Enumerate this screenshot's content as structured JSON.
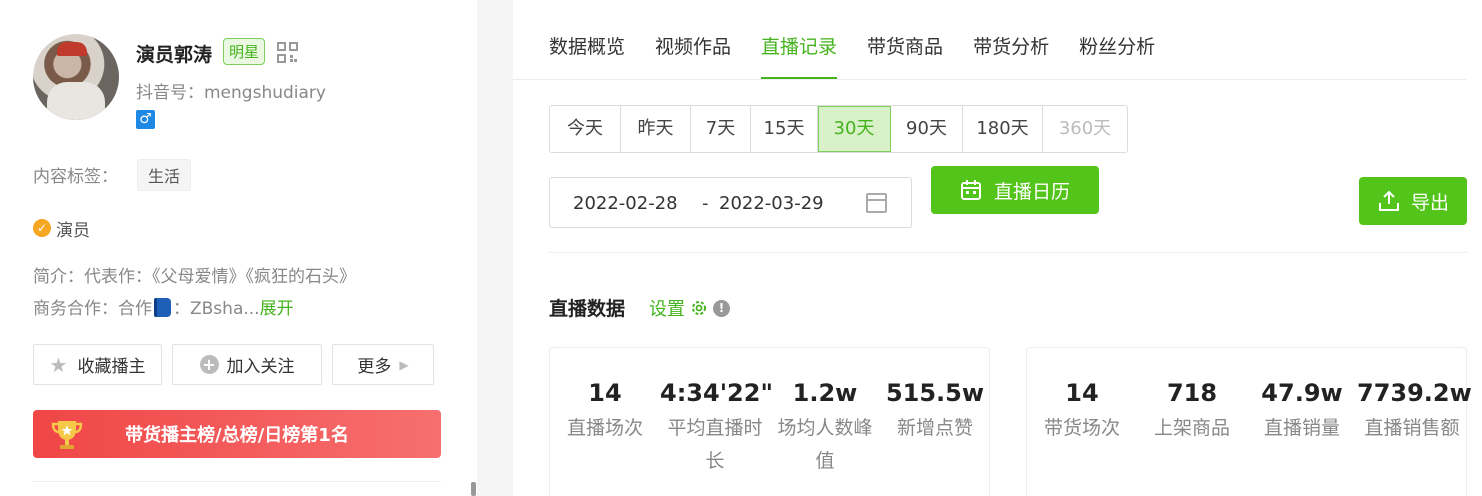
{
  "profile": {
    "name": "演员郭涛",
    "badge": "明星",
    "douyin_id": "抖音号：mengshudiary",
    "gender_symbol": "♂",
    "content_tag_label": "内容标签：",
    "content_tag": "生活",
    "verified_label": "演员",
    "intro": "简介：代表作：《父母爱情》《疯狂的石头》",
    "business_prefix": "商务合作：合作",
    "business_suffix": "：ZBsha...",
    "expand": "展开"
  },
  "actions": {
    "favorite": "收藏播主",
    "follow": "加入关注",
    "more": "更多"
  },
  "rank_banner": "带货播主榜/总榜/日榜第1名",
  "tabs": [
    {
      "label": "数据概览",
      "active": false
    },
    {
      "label": "视频作品",
      "active": false
    },
    {
      "label": "直播记录",
      "active": true
    },
    {
      "label": "带货商品",
      "active": false
    },
    {
      "label": "带货分析",
      "active": false
    },
    {
      "label": "粉丝分析",
      "active": false
    }
  ],
  "ranges": [
    {
      "label": "今天",
      "state": "normal"
    },
    {
      "label": "昨天",
      "state": "normal"
    },
    {
      "label": "7天",
      "state": "normal"
    },
    {
      "label": "15天",
      "state": "normal"
    },
    {
      "label": "30天",
      "state": "active"
    },
    {
      "label": "90天",
      "state": "normal"
    },
    {
      "label": "180天",
      "state": "normal"
    },
    {
      "label": "360天",
      "state": "disabled"
    }
  ],
  "date_range": {
    "start": "2022-02-28",
    "separator": "-",
    "end": "2022-03-29"
  },
  "buttons": {
    "calendar": "直播日历",
    "export": "导出"
  },
  "live_data": {
    "title": "直播数据",
    "settings": "设置",
    "card_a": [
      {
        "value": "14",
        "label": "直播场次"
      },
      {
        "value": "4:34'22\"",
        "label": "平均直播时长"
      },
      {
        "value": "1.2w",
        "label": "场均人数峰值"
      },
      {
        "value": "515.5w",
        "label": "新增点赞"
      }
    ],
    "card_b": [
      {
        "value": "14",
        "label": "带货场次"
      },
      {
        "value": "718",
        "label": "上架商品"
      },
      {
        "value": "47.9w",
        "label": "直播销量"
      },
      {
        "value": "7739.2w",
        "label": "直播销售额"
      }
    ]
  },
  "colors": {
    "accent": "#52c41a",
    "accent_text": "#45b41e",
    "banner": "#f04646"
  }
}
